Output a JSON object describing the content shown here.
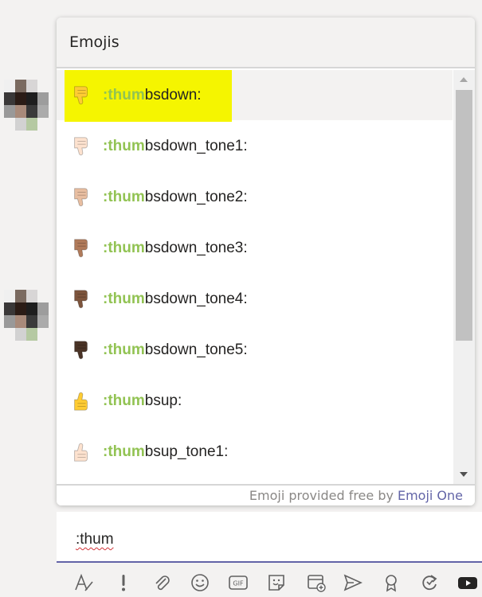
{
  "popup": {
    "title": "Emojis",
    "items": [
      {
        "match": ":thum",
        "rest": "bsdown:",
        "icon": "thumbs-down-icon",
        "tone": "#ffcc33",
        "selected": true
      },
      {
        "match": ":thum",
        "rest": "bsdown_tone1:",
        "icon": "thumbs-down-icon",
        "tone": "#fde2cf"
      },
      {
        "match": ":thum",
        "rest": "bsdown_tone2:",
        "icon": "thumbs-down-icon",
        "tone": "#e8bea1"
      },
      {
        "match": ":thum",
        "rest": "bsdown_tone3:",
        "icon": "thumbs-down-icon",
        "tone": "#b07a5a"
      },
      {
        "match": ":thum",
        "rest": "bsdown_tone4:",
        "icon": "thumbs-down-icon",
        "tone": "#7d543c"
      },
      {
        "match": ":thum",
        "rest": "bsdown_tone5:",
        "icon": "thumbs-down-icon",
        "tone": "#4a3326"
      },
      {
        "match": ":thum",
        "rest": "bsup:",
        "icon": "thumbs-up-icon",
        "tone": "#ffcc33"
      },
      {
        "match": ":thum",
        "rest": "bsup_tone1:",
        "icon": "thumbs-up-icon",
        "tone": "#fde2cf"
      }
    ],
    "footer_text": "Emoji provided free by",
    "footer_link": "Emoji One"
  },
  "compose": {
    "text": ":thum"
  },
  "toolbar": {
    "tools": [
      "format-icon",
      "important-icon",
      "attach-icon",
      "emoji-icon",
      "gif-icon",
      "sticker-icon",
      "schedule-meeting-icon",
      "stream-icon",
      "praise-icon",
      "loop-icon",
      "youtube-icon"
    ],
    "gif_label": "GIF"
  },
  "colors": {
    "accent": "#6264a7",
    "match": "#92c353",
    "highlight": "#f5f500"
  }
}
